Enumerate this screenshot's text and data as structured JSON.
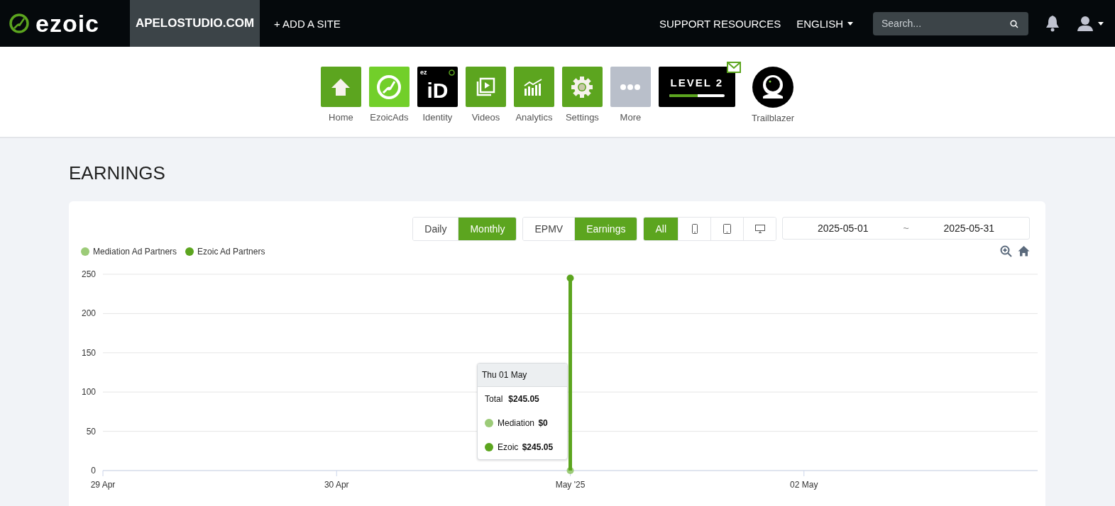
{
  "topbar": {
    "logo": "ezoic",
    "site": "APELOSTUDIO.COM",
    "add_site": "+ ADD A SITE",
    "support": "SUPPORT RESOURCES",
    "language": "ENGLISH",
    "search": {
      "placeholder": "Search..."
    }
  },
  "apps": [
    {
      "kind": "home",
      "label": "Home"
    },
    {
      "kind": "ezoicads",
      "label": "EzoicAds"
    },
    {
      "kind": "identity",
      "label": "Identity",
      "mini": "ez",
      "mark": "iD"
    },
    {
      "kind": "videos",
      "label": "Videos"
    },
    {
      "kind": "analytics",
      "label": "Analytics"
    },
    {
      "kind": "settings",
      "label": "Settings"
    },
    {
      "kind": "more",
      "label": "More"
    },
    {
      "kind": "level",
      "title": "LEVEL 2",
      "level": 0.52,
      "unread": true
    },
    {
      "kind": "avatar",
      "label": "Trailblazer"
    }
  ],
  "page_title": "EARNINGS",
  "period": [
    {
      "label": "Daily",
      "selected": false
    },
    {
      "label": "Monthly",
      "selected": true
    }
  ],
  "metric": [
    {
      "label": "EPMV",
      "selected": false
    },
    {
      "label": "Earnings",
      "selected": true
    }
  ],
  "devices": [
    {
      "kind": "text",
      "label": "All",
      "selected": true
    },
    {
      "kind": "phone",
      "selected": false
    },
    {
      "kind": "tablet",
      "selected": false
    },
    {
      "kind": "desktop",
      "selected": false
    }
  ],
  "date_range": {
    "start": "2025-05-01",
    "separator": "~",
    "end": "2025-05-31"
  },
  "chart": {
    "chart_data": {
      "type": "bar",
      "categories": [
        "29 Apr",
        "30 Apr",
        "May '25",
        "02 May"
      ],
      "ylim": [
        0,
        250
      ],
      "yticks": [
        0,
        50,
        100,
        150,
        200,
        250
      ],
      "series": [
        {
          "name": "Mediation Ad Partners",
          "color": "#9ccb78",
          "values": [
            null,
            null,
            0,
            null
          ]
        },
        {
          "name": "Ezoic Ad Partners",
          "color": "#5ca51f",
          "values": [
            null,
            null,
            245,
            null
          ]
        }
      ],
      "grid": true
    },
    "tooltip": {
      "title": "Thu 01 May",
      "total_label": "Total",
      "total": "$245.05",
      "rows": [
        {
          "label": "Mediation",
          "value": "$0",
          "color": "#9ccb78"
        },
        {
          "label": "Ezoic",
          "value": "$245.05",
          "color": "#5ca51f"
        }
      ]
    }
  }
}
